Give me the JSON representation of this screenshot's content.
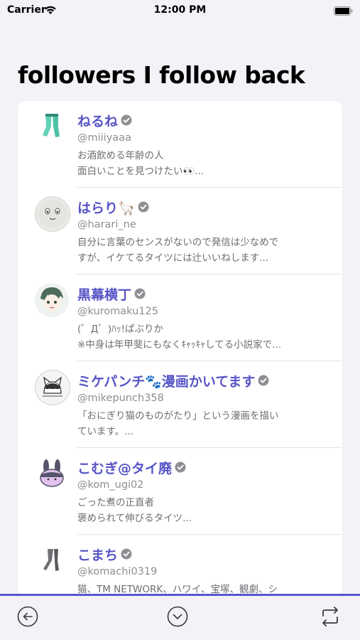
{
  "status_bar": {
    "carrier": "Carrier",
    "time": "12:00 PM"
  },
  "page": {
    "title": "followers I follow back"
  },
  "colors": {
    "accent": "#5755c6",
    "verified": "#8e8e93",
    "toolbar_line": "#5a58c8"
  },
  "followers": [
    {
      "name": "ねるね",
      "handle": "@miiiyaaa",
      "bio": [
        "お酒飲める年齢の人",
        "面白いことを見つけたい👀..."
      ],
      "verified": true,
      "avatar_icon": "green-legs-avatar"
    },
    {
      "name": "はらり🦙",
      "handle": "@harari_ne",
      "bio": [
        "自分に言葉のセンスがないので発信は少なめで",
        "すが、イケてるタイツには辻いいねします..."
      ],
      "verified": true,
      "avatar_icon": "smiling-face-avatar"
    },
    {
      "name": "黒幕横丁",
      "handle": "@kuromaku125",
      "bio": [
        "(゜Д゜)ﾊｯ!ぱぶりか",
        "※中身は年甲斐にもなくｷｬｯｷｬしてる小説家で..."
      ],
      "verified": true,
      "avatar_icon": "anime-character-avatar"
    },
    {
      "name": "ミケパンチ🐾漫画かいてます",
      "handle": "@mikepunch358",
      "bio": [
        "「おにぎり猫のものがたり」という漫画を描い",
        "ています。..."
      ],
      "verified": true,
      "avatar_icon": "cat-sketch-avatar"
    },
    {
      "name": "こむぎ@タイ廃",
      "handle": "@kom_ugi02",
      "bio": [
        "ごった煮の正直者",
        "褒められて伸びるタイツ..."
      ],
      "verified": true,
      "avatar_icon": "purple-bunny-avatar"
    },
    {
      "name": "こまち",
      "handle": "@komachi0319",
      "bio": [
        "猫、TM NETWORK、ハワイ、宝塚、観劇、シ"
      ],
      "verified": true,
      "avatar_icon": "legs-sketch-avatar"
    }
  ],
  "toolbar": {
    "back_icon": "arrow-left-circle-icon",
    "down_icon": "chevron-down-circle-icon",
    "repost_icon": "repost-arrows-icon"
  }
}
